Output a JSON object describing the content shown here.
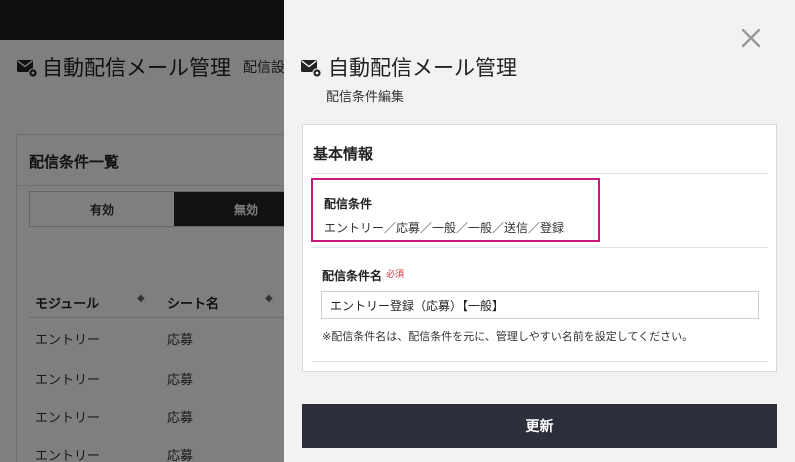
{
  "background": {
    "title": "自動配信メール管理",
    "subtitle": "配信設",
    "card_title": "配信条件一覧",
    "toggle": {
      "active": "有効",
      "inactive": "無効"
    },
    "columns": [
      "モジュール",
      "シート名"
    ],
    "rows": [
      [
        "エントリー",
        "応募"
      ],
      [
        "エントリー",
        "応募"
      ],
      [
        "エントリー",
        "応募"
      ],
      [
        "エントリー",
        "応募"
      ]
    ]
  },
  "drawer": {
    "title": "自動配信メール管理",
    "subtitle": "配信条件編集",
    "section_title": "基本情報",
    "condition": {
      "label": "配信条件",
      "value": "エントリー／応募／一般／一般／送信／登録"
    },
    "name_field": {
      "label": "配信条件名",
      "required": "必須",
      "value": "エントリー登録（応募）【一般】"
    },
    "hint": "※配信条件名は、配信条件を元に、管理しやすい名前を設定してください。",
    "submit_label": "更新"
  },
  "colors": {
    "accent_border": "#c8197e",
    "button_bg": "#2c2f3a",
    "required": "#d0303c"
  },
  "icons": {
    "mail_gear": "mail-gear-icon",
    "close": "close-icon",
    "sort": "sort-icon"
  }
}
